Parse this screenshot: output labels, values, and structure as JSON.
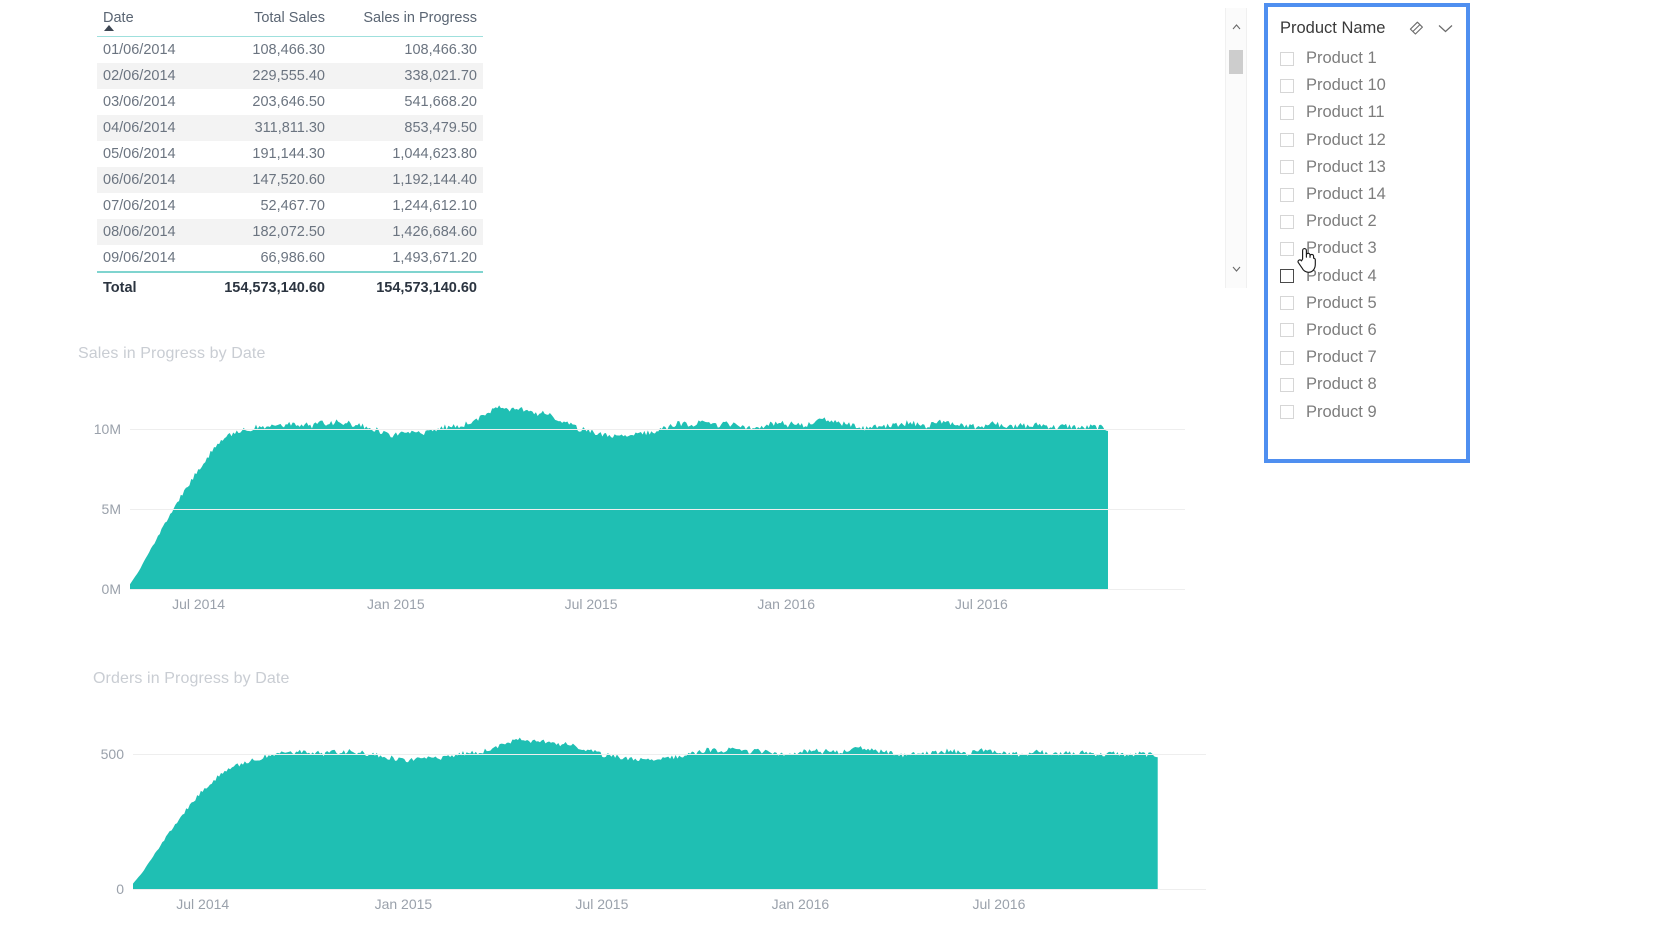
{
  "table": {
    "name": "sales-by-date-table",
    "columns": [
      "Date",
      "Total Sales",
      "Sales in Progress"
    ],
    "sort_column": "Date",
    "sort_direction": "ascending",
    "rows": [
      {
        "date": "01/06/2014",
        "total_sales": "108,466.30",
        "sales_in_progress": "108,466.30"
      },
      {
        "date": "02/06/2014",
        "total_sales": "229,555.40",
        "sales_in_progress": "338,021.70"
      },
      {
        "date": "03/06/2014",
        "total_sales": "203,646.50",
        "sales_in_progress": "541,668.20"
      },
      {
        "date": "04/06/2014",
        "total_sales": "311,811.30",
        "sales_in_progress": "853,479.50"
      },
      {
        "date": "05/06/2014",
        "total_sales": "191,144.30",
        "sales_in_progress": "1,044,623.80"
      },
      {
        "date": "06/06/2014",
        "total_sales": "147,520.60",
        "sales_in_progress": "1,192,144.40"
      },
      {
        "date": "07/06/2014",
        "total_sales": "52,467.70",
        "sales_in_progress": "1,244,612.10"
      },
      {
        "date": "08/06/2014",
        "total_sales": "182,072.50",
        "sales_in_progress": "1,426,684.60"
      },
      {
        "date": "09/06/2014",
        "total_sales": "66,986.60",
        "sales_in_progress": "1,493,671.20"
      }
    ],
    "total_row": {
      "label": "Total",
      "total_sales": "154,573,140.60",
      "sales_in_progress": "154,573,140.60"
    }
  },
  "scrollbar": {
    "up_arrow": "chevron-up",
    "down_arrow": "chevron-down"
  },
  "slicer": {
    "title": "Product Name",
    "clear_icon": "eraser-icon",
    "expand_icon": "chevron-down-icon",
    "border_color": "#4f8ff0",
    "items": [
      {
        "label": "Product 1",
        "checked": false,
        "hovered": false
      },
      {
        "label": "Product 10",
        "checked": false,
        "hovered": false
      },
      {
        "label": "Product 11",
        "checked": false,
        "hovered": false
      },
      {
        "label": "Product 12",
        "checked": false,
        "hovered": false
      },
      {
        "label": "Product 13",
        "checked": false,
        "hovered": false
      },
      {
        "label": "Product 14",
        "checked": false,
        "hovered": false
      },
      {
        "label": "Product 2",
        "checked": false,
        "hovered": false
      },
      {
        "label": "Product 3",
        "checked": false,
        "hovered": false
      },
      {
        "label": "Product 4",
        "checked": false,
        "hovered": true
      },
      {
        "label": "Product 5",
        "checked": false,
        "hovered": false
      },
      {
        "label": "Product 6",
        "checked": false,
        "hovered": false
      },
      {
        "label": "Product 7",
        "checked": false,
        "hovered": false
      },
      {
        "label": "Product 8",
        "checked": false,
        "hovered": false
      },
      {
        "label": "Product 9",
        "checked": false,
        "hovered": false
      }
    ]
  },
  "cursor": {
    "type": "pointing-hand-cursor"
  },
  "chart_data": [
    {
      "id": "sales-in-progress",
      "type": "area",
      "title": "Sales in Progress by Date",
      "xlabel": "",
      "ylabel": "",
      "color": "#1FBFB3",
      "grid": true,
      "legend": "none",
      "ylim": [
        0,
        12500000
      ],
      "yticks": [
        0,
        5000000,
        10000000
      ],
      "ytick_labels": [
        "0M",
        "5M",
        "10M"
      ],
      "x": [
        "Jul 2014",
        "Jan 2015",
        "Jul 2015",
        "Jan 2016",
        "Jul 2016"
      ],
      "xtick_positions": [
        0.065,
        0.252,
        0.437,
        0.622,
        0.807
      ],
      "values": [
        300000,
        1100000,
        2100000,
        3050000,
        4050000,
        5000000,
        5900000,
        6700000,
        7500000,
        8250000,
        8900000,
        9400000,
        9750000,
        9950000,
        10050000,
        10150000,
        10050000,
        10250000,
        10200000,
        10350000,
        10300000,
        10200000,
        10400000,
        10300000,
        10450000,
        10400000,
        10250000,
        10150000,
        10050000,
        9800000,
        9600000,
        9750000,
        9650000,
        9800000,
        9700000,
        9900000,
        10050000,
        10200000,
        10150000,
        10350000,
        10550000,
        10900000,
        11300000,
        11500000,
        11200000,
        11350000,
        11100000,
        10900000,
        11000000,
        10700000,
        10450000,
        10200000,
        10000000,
        9850000,
        9700000,
        9600000,
        9500000,
        9650000,
        9600000,
        9700000,
        9800000,
        9900000,
        10100000,
        10300000,
        10350000,
        10250000,
        10400000,
        10300000,
        10200000,
        10350000,
        10250000,
        10150000,
        10050000,
        10150000,
        10300000,
        10400000,
        10250000,
        10350000,
        10200000,
        10450000,
        10600000,
        10500000,
        10350000,
        10250000,
        10150000,
        10050000,
        10150000,
        10250000,
        10150000,
        10300000,
        10400000,
        10300000,
        10200000,
        10350000,
        10500000,
        10400000,
        10300000,
        10200000,
        10100000,
        10250000,
        10350000,
        10200000,
        10100000,
        10250000,
        10150000,
        10300000,
        10200000,
        10100000,
        10200000,
        10150000,
        10050000,
        10150000,
        10100000,
        10000000
      ]
    },
    {
      "id": "orders-in-progress",
      "type": "area",
      "title": "Orders in Progress by Date",
      "xlabel": "",
      "ylabel": "",
      "color": "#1FBFB3",
      "grid": true,
      "legend": "none",
      "ylim": [
        0,
        650
      ],
      "yticks": [
        0,
        500
      ],
      "ytick_labels": [
        "0",
        "500"
      ],
      "x": [
        "Jul 2014",
        "Jan 2015",
        "Jul 2015",
        "Jan 2016",
        "Jul 2016"
      ],
      "xtick_positions": [
        0.065,
        0.252,
        0.437,
        0.622,
        0.807
      ],
      "values": [
        20,
        60,
        110,
        160,
        210,
        255,
        300,
        340,
        375,
        405,
        430,
        450,
        465,
        478,
        487,
        495,
        500,
        508,
        505,
        512,
        508,
        502,
        510,
        505,
        512,
        508,
        500,
        496,
        490,
        482,
        478,
        484,
        480,
        488,
        484,
        492,
        500,
        508,
        505,
        515,
        525,
        540,
        555,
        562,
        548,
        553,
        543,
        535,
        538,
        526,
        516,
        506,
        498,
        492,
        486,
        482,
        478,
        484,
        480,
        486,
        492,
        498,
        506,
        514,
        517,
        512,
        518,
        513,
        508,
        514,
        509,
        504,
        499,
        504,
        511,
        515,
        509,
        514,
        507,
        518,
        524,
        519,
        512,
        507,
        502,
        497,
        502,
        507,
        502,
        509,
        514,
        509,
        504,
        511,
        518,
        513,
        508,
        503,
        498,
        505,
        511,
        504,
        499,
        506,
        501,
        509,
        503,
        498,
        505,
        501,
        495,
        503,
        499,
        496
      ]
    }
  ]
}
